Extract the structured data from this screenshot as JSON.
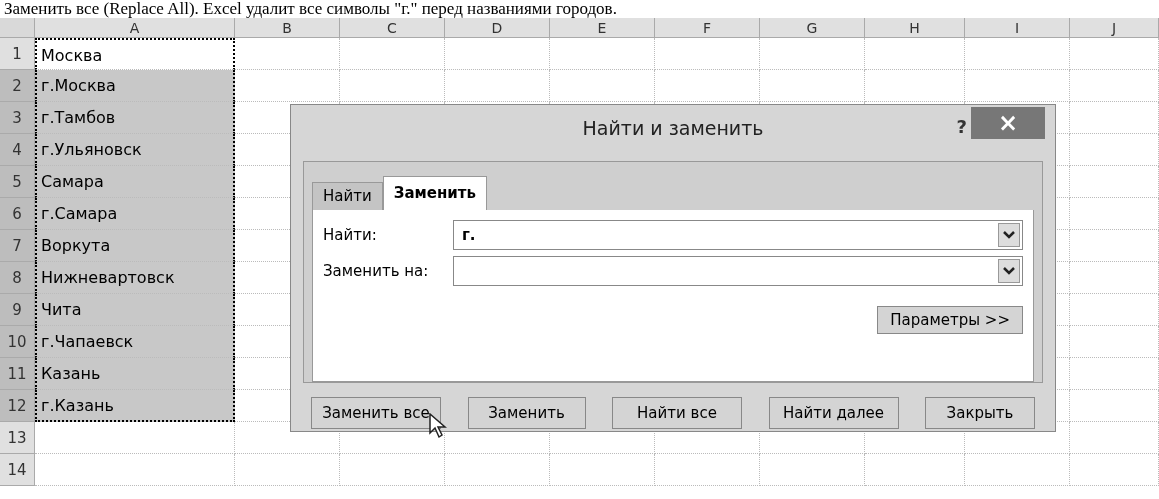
{
  "caption": "Заменить все (Replace All). Excel удалит все символы \"г.\" перед названиями городов.",
  "sheet": {
    "columns": [
      "A",
      "B",
      "C",
      "D",
      "E",
      "F",
      "G",
      "H",
      "I",
      "J"
    ],
    "rows": [
      {
        "number": "1",
        "value": "Москва",
        "selected": false
      },
      {
        "number": "2",
        "value": "г.Москва",
        "selected": true
      },
      {
        "number": "3",
        "value": "г.Тамбов",
        "selected": true
      },
      {
        "number": "4",
        "value": "г.Ульяновск",
        "selected": true
      },
      {
        "number": "5",
        "value": "Самара",
        "selected": true
      },
      {
        "number": "6",
        "value": "г.Самара",
        "selected": true
      },
      {
        "number": "7",
        "value": "Воркута",
        "selected": true
      },
      {
        "number": "8",
        "value": "Нижневартовск",
        "selected": true
      },
      {
        "number": "9",
        "value": "Чита",
        "selected": true
      },
      {
        "number": "10",
        "value": "г.Чапаевск",
        "selected": true
      },
      {
        "number": "11",
        "value": "Казань",
        "selected": true
      },
      {
        "number": "12",
        "value": "г.Казань",
        "selected": true
      },
      {
        "number": "13",
        "selected": false
      },
      {
        "number": "14",
        "selected": false
      }
    ]
  },
  "dialog": {
    "title": "Найти и заменить",
    "help": "?",
    "close": "×",
    "tabs": [
      {
        "label": "Найти",
        "selected": false
      },
      {
        "label": "Заменить",
        "selected": true
      }
    ],
    "fields": [
      {
        "label": "Найти:",
        "value": "г."
      },
      {
        "label": "Заменить на:"
      }
    ],
    "options_button": "Параметры >>",
    "buttons": [
      "Заменить все",
      "Заменить",
      "Найти все",
      "Найти далее",
      "Закрыть"
    ]
  }
}
